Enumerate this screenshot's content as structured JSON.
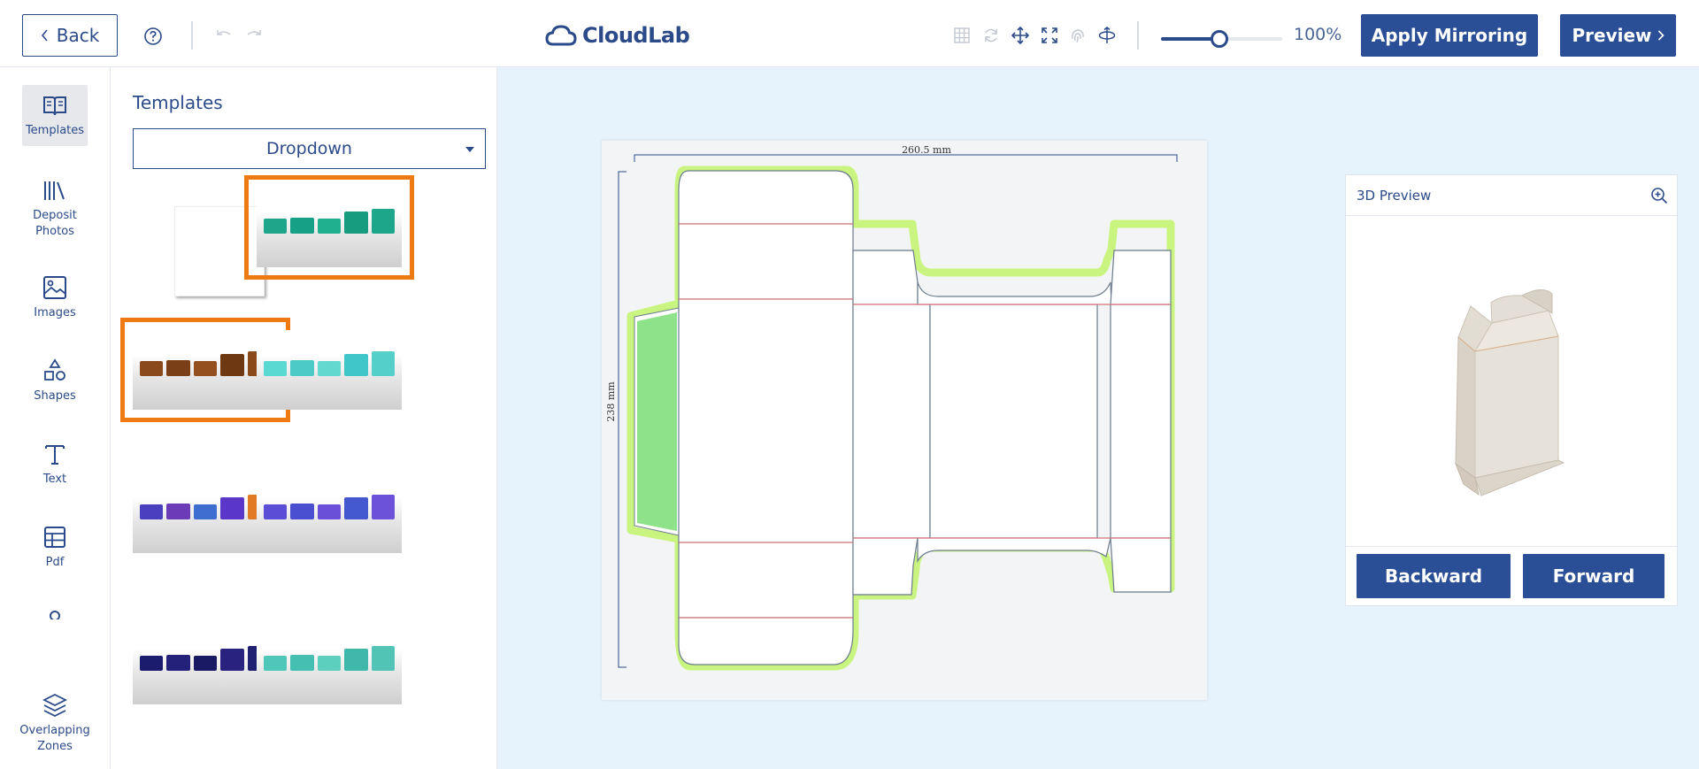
{
  "header": {
    "back_label": "Back",
    "logo_text": "CloudLab",
    "zoom_label": "100%",
    "zoom_level": 0.48,
    "apply_label": "Apply Mirroring",
    "preview_label": "Preview",
    "tool_icons": [
      "grid-icon",
      "rotate-icon",
      "move-icon",
      "fit-screen-icon",
      "fingerprint-icon",
      "orbit-icon"
    ]
  },
  "nav": {
    "items": [
      {
        "label": "Templates",
        "icon": "book-open-icon",
        "active": true
      },
      {
        "label": "Deposit Photos",
        "icon": "library-icon"
      },
      {
        "label": "Images",
        "icon": "image-icon"
      },
      {
        "label": "Shapes",
        "icon": "shapes-icon"
      },
      {
        "label": "Text",
        "icon": "text-icon"
      },
      {
        "label": "Pdf",
        "icon": "table-icon"
      },
      {
        "label": "Overlapping Zones",
        "icon": "layers-icon"
      }
    ]
  },
  "templates": {
    "title": "Templates",
    "dropdown_value": "Dropdown",
    "thumbnails": [
      {
        "style": "blank"
      },
      {
        "style": "teal",
        "selected": true,
        "colors": [
          "#1fa58a",
          "#16a085",
          "#20b090",
          "#179c80",
          "#1ea68b"
        ]
      },
      {
        "style": "brown",
        "selected": true,
        "colors": [
          "#8b4a1c",
          "#7a3f16",
          "#94511f",
          "#6e3812",
          "#8a4a1a"
        ]
      },
      {
        "style": "cyan",
        "colors": [
          "#5ad8d2",
          "#4ccac8",
          "#62d9cf",
          "#3ec6c8",
          "#55cfc9"
        ]
      },
      {
        "style": "rainbow",
        "colors": [
          "#4a3fbf",
          "#6b3bb8",
          "#3e6fd0",
          "#5a36c9",
          "#e07a25"
        ]
      },
      {
        "style": "violet",
        "colors": [
          "#5b4ed6",
          "#4a4ed1",
          "#6a4fd8",
          "#4458cf",
          "#6b52d9"
        ]
      },
      {
        "style": "navy",
        "colors": [
          "#1c1c6e",
          "#24217a",
          "#1a1a64",
          "#29227f",
          "#202070"
        ]
      },
      {
        "style": "mint",
        "colors": [
          "#4fc7b8",
          "#45bfb2",
          "#5ccfbf",
          "#3fb8aa",
          "#52c4b6"
        ]
      }
    ]
  },
  "canvas": {
    "width_label": "260.5 mm",
    "height_label": "238 mm"
  },
  "preview3d": {
    "title": "3D Preview",
    "backward_label": "Backward",
    "forward_label": "Forward"
  }
}
